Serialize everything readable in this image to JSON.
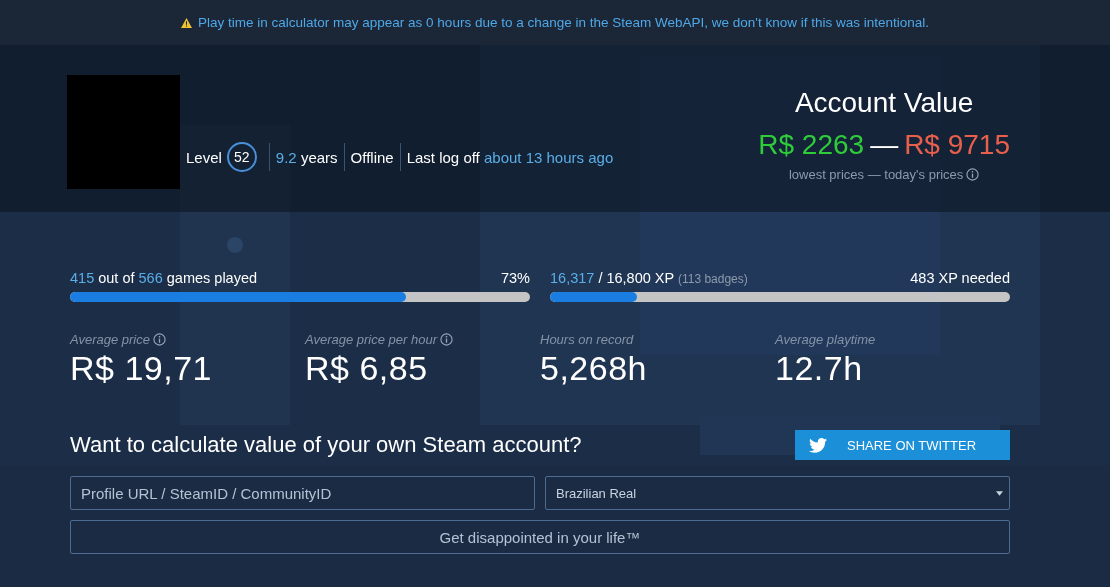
{
  "notice": {
    "text": "Play time in calculator may appear as 0 hours due to a change in the Steam WebAPI, we don't know if this was intentional."
  },
  "profile": {
    "level_label": "Level",
    "level": "52",
    "years_value": "9.2",
    "years_label": "years",
    "status": "Offline",
    "last_logoff_label": "Last log off",
    "last_logoff_value": "about 13 hours ago"
  },
  "account_value": {
    "title": "Account Value",
    "low": "R$ 2263",
    "separator": "—",
    "high": "R$ 9715",
    "caption": "lowest prices — today's prices"
  },
  "games_progress": {
    "played": "415",
    "middle": "out of",
    "total": "566",
    "suffix": "games played",
    "percent": "73%",
    "level": 0.73
  },
  "xp_progress": {
    "current": "16,317",
    "rest": "/ 16,800 XP",
    "badges": "(113 badges)",
    "needed": "483 XP needed",
    "level": 0.19
  },
  "stats": [
    {
      "label": "Average price",
      "value": "R$ 19,71",
      "info": true
    },
    {
      "label": "Average price per hour",
      "value": "R$ 6,85",
      "info": true
    },
    {
      "label": "Hours on record",
      "value": "5,268h",
      "info": false
    },
    {
      "label": "Average playtime",
      "value": "12.7h",
      "info": false
    }
  ],
  "calculator": {
    "heading": "Want to calculate value of your own Steam account?",
    "share_button": "SHARE ON TWITTER",
    "profile_field": {
      "placeholder": "Profile URL / SteamID / CommunityID"
    },
    "currency": {
      "value": "Brazilian Real"
    },
    "submit": "Get disappointed in your life™"
  }
}
